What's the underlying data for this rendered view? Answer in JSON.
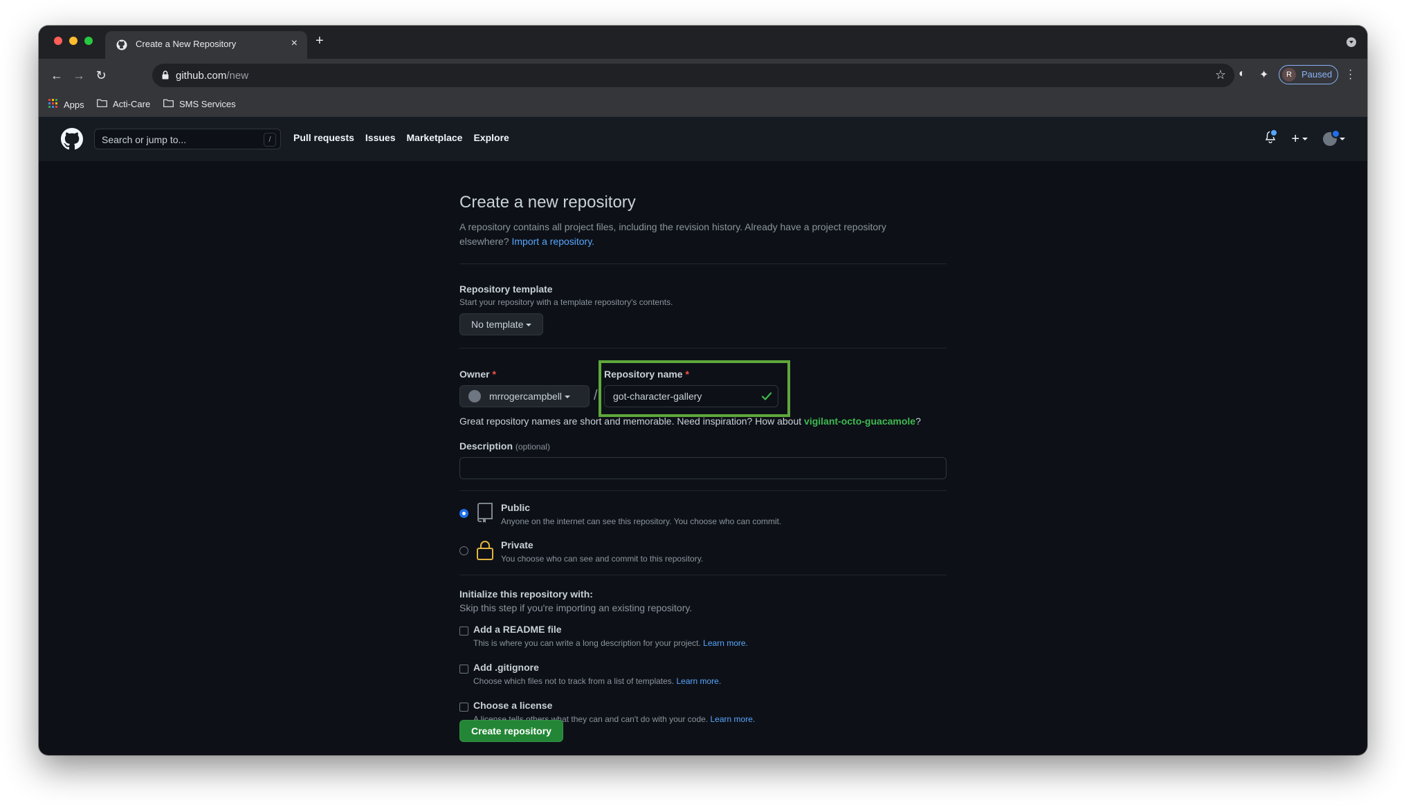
{
  "browser": {
    "tab_title": "Create a New Repository",
    "url_host": "github.com",
    "url_path": "/new",
    "profile_initial": "R",
    "profile_status": "Paused",
    "bookmarks": [
      "Apps",
      "Acti-Care",
      "SMS Services"
    ]
  },
  "header": {
    "search_placeholder": "Search or jump to...",
    "search_shortcut": "/",
    "nav": [
      "Pull requests",
      "Issues",
      "Marketplace",
      "Explore"
    ]
  },
  "form": {
    "title": "Create a new repository",
    "subtitle": "A repository contains all project files, including the revision history. Already have a project repository elsewhere?",
    "import_link": "Import a repository.",
    "template_label": "Repository template",
    "template_note": "Start your repository with a template repository's contents.",
    "template_button": "No template",
    "owner_label": "Owner",
    "required_mark": "*",
    "owner_value": "mrrogercampbell",
    "name_label": "Repository name",
    "name_value": "got-character-gallery",
    "inspiration_text": "Great repository names are short and memorable. Need inspiration? How about",
    "inspiration_suggestion": "vigilant-octo-guacamole",
    "inspiration_end": "?",
    "description_label": "Description",
    "description_optional": "(optional)",
    "description_value": "",
    "visibility": [
      {
        "title": "Public",
        "sub": "Anyone on the internet can see this repository. You choose who can commit.",
        "checked": true
      },
      {
        "title": "Private",
        "sub": "You choose who can see and commit to this repository.",
        "checked": false
      }
    ],
    "init_label": "Initialize this repository with:",
    "init_note": "Skip this step if you're importing an existing repository.",
    "init_options": [
      {
        "title": "Add a README file",
        "sub": "This is where you can write a long description for your project.",
        "link": "Learn more."
      },
      {
        "title": "Add .gitignore",
        "sub": "Choose which files not to track from a list of templates.",
        "link": "Learn more."
      },
      {
        "title": "Choose a license",
        "sub": "A license tells others what they can and can't do with your code.",
        "link": "Learn more."
      }
    ],
    "submit_label": "Create repository"
  },
  "colors": {
    "highlight": "#5fa83b",
    "page_bg": "#0d1117",
    "header_bg": "#161b22",
    "link": "#58a6ff",
    "primary_button": "#238636"
  }
}
